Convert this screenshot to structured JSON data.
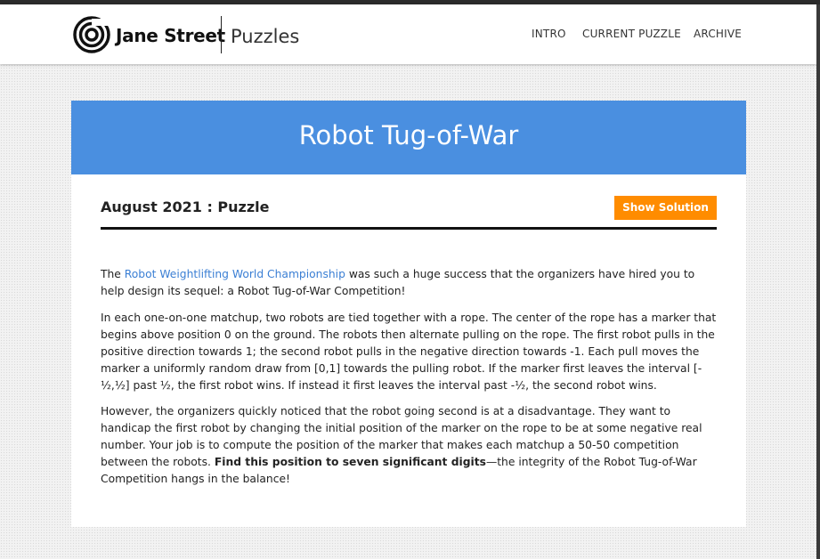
{
  "header": {
    "brand": "Jane Street",
    "section": "Puzzles",
    "nav": [
      "INTRO",
      "CURRENT PUZZLE",
      "ARCHIVE"
    ]
  },
  "banner": {
    "title": "Robot Tug-of-War"
  },
  "puzzle": {
    "date_label": "August 2021 : Puzzle",
    "solution_button": "Show Solution"
  },
  "content": {
    "p1_before": "The ",
    "p1_link": "Robot Weightlifting World Championship",
    "p1_after": " was such a huge success that the organizers have hired you to help design its sequel: a Robot Tug-of-War Competition!",
    "p2": "In each one-on-one matchup, two robots are tied together with a rope. The center of the rope has a marker that begins above position 0 on the ground. The robots then alternate pulling on the rope. The first robot pulls in the positive direction towards 1; the second robot pulls in the negative direction towards -1. Each pull moves the marker a uniformly random draw from [0,1] towards the pulling robot. If the marker first leaves the interval [-½,½] past ½, the first robot wins. If instead it first leaves the interval past -½, the second robot wins.",
    "p3_before": "However, the organizers quickly noticed that the robot going second is at a disadvantage. They want to handicap the first robot by changing the initial position of the marker on the rope to be at some negative real number. Your job is to compute the position of the marker that makes each matchup a 50-50 competition between the robots. ",
    "p3_bold": "Find this position to seven significant digits",
    "p3_after": "—the integrity of the Robot Tug-of-War Competition hangs in the balance!"
  },
  "colors": {
    "banner": "#4a8fe0",
    "button": "#ff8c00",
    "link": "#3b7fd4"
  }
}
